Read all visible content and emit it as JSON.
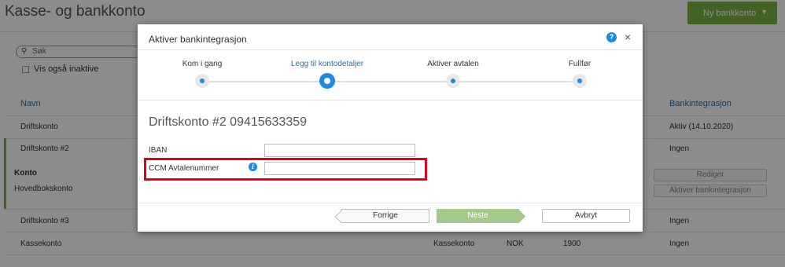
{
  "page": {
    "title": "Kasse- og bankkonto",
    "new_button": "Ny bankkonto",
    "search_placeholder": "Søk",
    "show_inactive": "Vis også inaktive",
    "columns": {
      "name": "Navn",
      "bank_integration": "Bankintegrasjon"
    },
    "rows": [
      {
        "name": "Driftskonto",
        "bank_integration": "Aktiv (14.10.2020)"
      },
      {
        "name": "Driftskonto #2",
        "bank_integration": "Ingen"
      },
      {
        "name": "Driftskonto #3",
        "bank_integration": "Ingen"
      },
      {
        "name": "Kassekonto",
        "type": "Kassekonto",
        "currency": "NOK",
        "number": "1900",
        "bank_integration": "Ingen"
      }
    ],
    "detail": {
      "label": "Konto",
      "value": "Hovedbokskonto"
    },
    "edit_button": "Rediger",
    "activate_button": "Aktiver bankintegrasjon"
  },
  "modal": {
    "title": "Aktiver bankintegrasjon",
    "steps": [
      {
        "label": "Kom i gang",
        "active": false
      },
      {
        "label": "Legg til kontodetaljer",
        "active": true
      },
      {
        "label": "Aktiver avtalen",
        "active": false
      },
      {
        "label": "Fullfør",
        "active": false
      }
    ],
    "account_title": "Driftskonto #2 09415633359",
    "fields": {
      "iban_label": "IBAN",
      "iban_value": "",
      "ccm_label": "CCM Avtalenummer",
      "ccm_value": ""
    },
    "buttons": {
      "prev": "Forrige",
      "next": "Neste",
      "cancel": "Avbryt"
    }
  },
  "colors": {
    "accent": "#1e88e5",
    "brand_green": "#7cb342",
    "highlight": "#e0001b"
  }
}
